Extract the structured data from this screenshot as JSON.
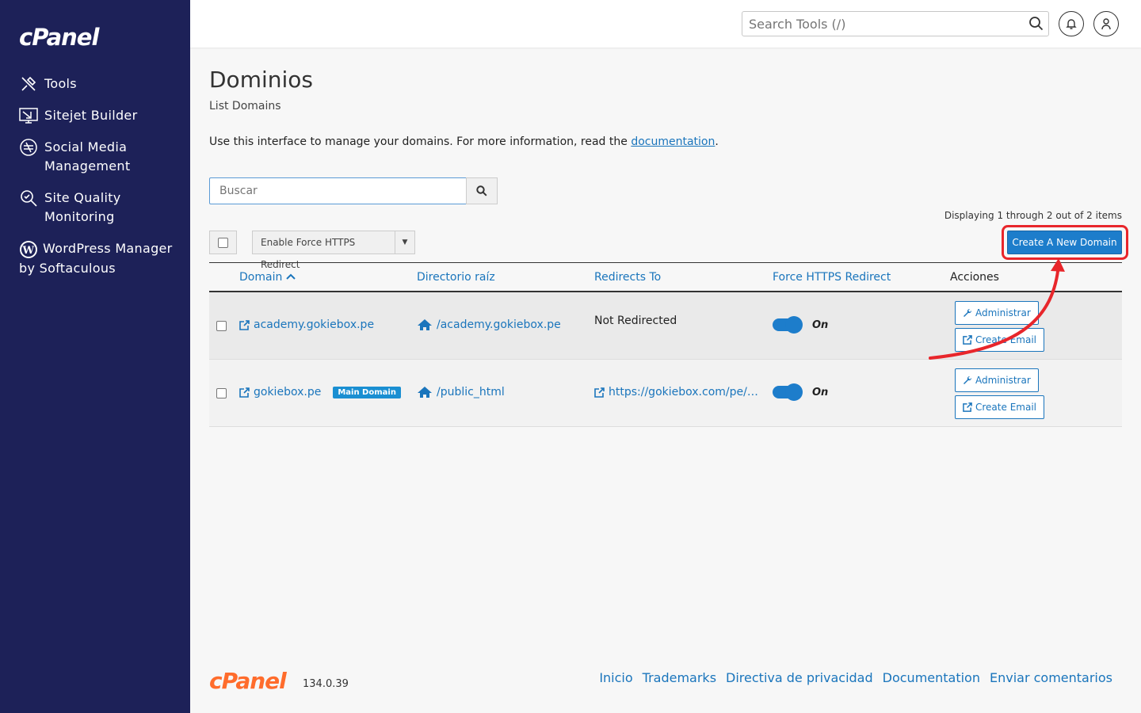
{
  "sidebar": {
    "logo": "cPanel",
    "items": [
      {
        "label": "Tools",
        "icon": "tools-icon"
      },
      {
        "label": "Sitejet Builder",
        "icon": "sitejet-icon"
      },
      {
        "label": "Social Media Management",
        "icon": "social-media-icon"
      },
      {
        "label": "Site Quality Monitoring",
        "icon": "site-quality-icon"
      },
      {
        "label": "WordPress Manager by Softaculous",
        "icon": "wordpress-icon"
      }
    ]
  },
  "header": {
    "search_placeholder": "Search Tools (/)"
  },
  "page": {
    "title": "Dominios",
    "subtitle": "List Domains",
    "intro_text": "Use this interface to manage your domains. For more information, read the ",
    "intro_link": "documentation",
    "intro_end": ".",
    "search_placeholder": "Buscar",
    "displaying": "Displaying 1 through 2 out of 2 items",
    "bulk_action": "Enable Force HTTPS Redirect",
    "create_button": "Create A New Domain"
  },
  "table": {
    "headers": {
      "domain": "Domain",
      "root": "Directorio raíz",
      "redirects": "Redirects To",
      "force_https": "Force HTTPS Redirect",
      "actions": "Acciones"
    },
    "rows": [
      {
        "domain": "academy.gokiebox.pe",
        "badge": "",
        "root": "/academy.gokiebox.pe",
        "redirect": "Not Redirected",
        "https": "On",
        "manage": "Administrar",
        "email": "Create Email"
      },
      {
        "domain": "gokiebox.pe",
        "badge": "Main Domain",
        "root": "/public_html",
        "redirect": "https://gokiebox.com/pe/…",
        "https": "On",
        "manage": "Administrar",
        "email": "Create Email"
      }
    ]
  },
  "footer": {
    "logo": "cPanel",
    "version": "134.0.39",
    "links": [
      "Inicio",
      "Trademarks",
      "Directiva de privacidad",
      "Documentation",
      "Enviar comentarios"
    ]
  },
  "colors": {
    "sidebar": "#1d2158",
    "accent": "#1d7dcb",
    "link": "#1a75bc",
    "highlight": "#e8262b",
    "footer_logo": "#ff6c2c"
  }
}
